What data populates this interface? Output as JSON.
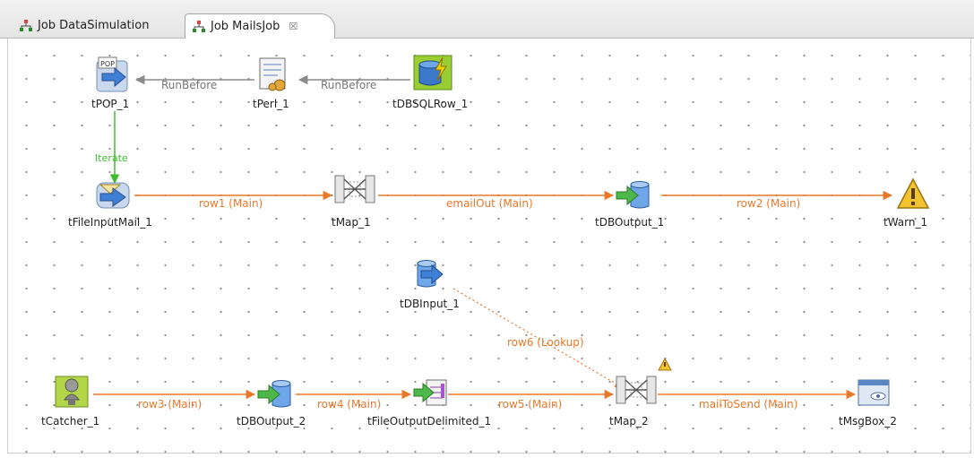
{
  "tabs": [
    {
      "label": "Job DataSimulation",
      "active": false
    },
    {
      "label": "Job MailsJob",
      "active": true,
      "close_icon": "close-x-icon"
    }
  ],
  "colors": {
    "main_link": "#e8782a",
    "trigger_link": "#8a8a8a",
    "iterate_link": "#3dbb2e",
    "lookup_link": "#e8782a"
  },
  "components": [
    {
      "id": "tPOP_1",
      "label": "tPOP_1",
      "icon": "pop-mail-icon"
    },
    {
      "id": "tPerl_1",
      "label": "tPerl_1",
      "icon": "perl-script-icon"
    },
    {
      "id": "tDBSQLRow_1",
      "label": "tDBSQLRow_1",
      "icon": "db-sql-row-icon"
    },
    {
      "id": "tFileInputMail_1",
      "label": "tFileInputMail_1",
      "icon": "file-input-mail-icon"
    },
    {
      "id": "tMap_1",
      "label": "tMap_1",
      "icon": "map-icon"
    },
    {
      "id": "tDBOutput_1",
      "label": "tDBOutput_1",
      "icon": "db-output-icon"
    },
    {
      "id": "tWarn_1",
      "label": "tWarn_1",
      "icon": "warning-icon"
    },
    {
      "id": "tDBInput_1",
      "label": "tDBInput_1",
      "icon": "db-input-icon"
    },
    {
      "id": "tCatcher_1",
      "label": "tCatcher_1",
      "icon": "catcher-icon"
    },
    {
      "id": "tDBOutput_2",
      "label": "tDBOutput_2",
      "icon": "db-output-icon"
    },
    {
      "id": "tFileOutputDelimited_1",
      "label": "tFileOutputDelimited_1",
      "icon": "file-output-delimited-icon"
    },
    {
      "id": "tMap_2",
      "label": "tMap_2",
      "icon": "map-icon",
      "badge": "warning-badge-icon"
    },
    {
      "id": "tMsgBox_2",
      "label": "tMsgBox_2",
      "icon": "message-box-icon"
    }
  ],
  "connections": [
    {
      "from": "tDBSQLRow_1",
      "to": "tPerl_1",
      "type": "trigger",
      "label": "RunBefore"
    },
    {
      "from": "tPerl_1",
      "to": "tPOP_1",
      "type": "trigger",
      "label": "RunBefore"
    },
    {
      "from": "tPOP_1",
      "to": "tFileInputMail_1",
      "type": "iterate",
      "label": "Iterate"
    },
    {
      "from": "tFileInputMail_1",
      "to": "tMap_1",
      "type": "main",
      "label": "row1 (Main)"
    },
    {
      "from": "tMap_1",
      "to": "tDBOutput_1",
      "type": "main",
      "label": "emailOut (Main)"
    },
    {
      "from": "tDBOutput_1",
      "to": "tWarn_1",
      "type": "main",
      "label": "row2 (Main)"
    },
    {
      "from": "tDBInput_1",
      "to": "tMap_2",
      "type": "lookup",
      "label": "row6 (Lookup)"
    },
    {
      "from": "tCatcher_1",
      "to": "tDBOutput_2",
      "type": "main",
      "label": "row3 (Main)"
    },
    {
      "from": "tDBOutput_2",
      "to": "tFileOutputDelimited_1",
      "type": "main",
      "label": "row4 (Main)"
    },
    {
      "from": "tFileOutputDelimited_1",
      "to": "tMap_2",
      "type": "main",
      "label": "row5 (Main)"
    },
    {
      "from": "tMap_2",
      "to": "tMsgBox_2",
      "type": "main",
      "label": "mailToSend (Main)"
    }
  ]
}
